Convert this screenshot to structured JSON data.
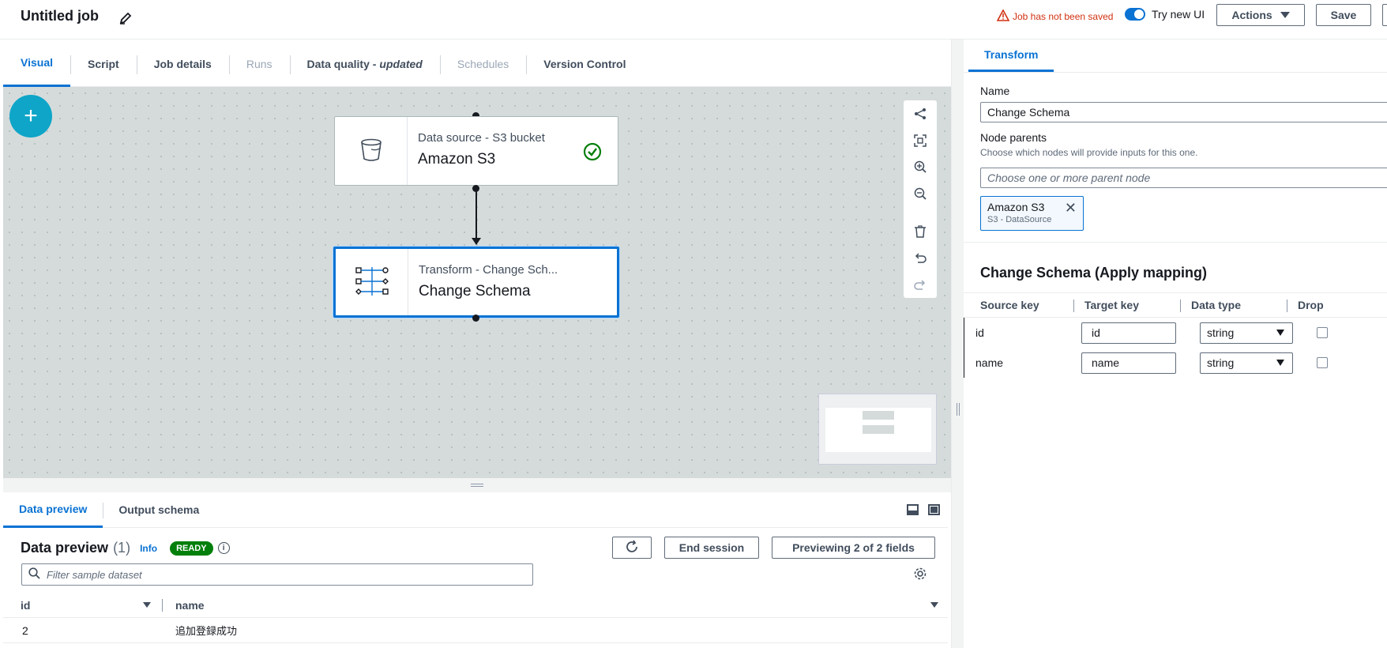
{
  "header": {
    "job_title": "Untitled job",
    "unsaved_warning": "Job has not been saved",
    "try_new_ui_label": "Try new UI",
    "actions_label": "Actions",
    "save_label": "Save"
  },
  "tabs": [
    {
      "label": "Visual",
      "state": "active"
    },
    {
      "label": "Script",
      "state": "normal"
    },
    {
      "label": "Job details",
      "state": "normal"
    },
    {
      "label": "Runs",
      "state": "disabled"
    },
    {
      "label": "Data quality -",
      "suffix": "updated",
      "state": "normal"
    },
    {
      "label": "Schedules",
      "state": "disabled"
    },
    {
      "label": "Version Control",
      "state": "normal"
    }
  ],
  "canvas": {
    "add_node_label": "+",
    "nodes": [
      {
        "subtitle": "Data source - S3 bucket",
        "title": "Amazon S3",
        "status": "success"
      },
      {
        "subtitle": "Transform - Change Sch...",
        "title": "Change Schema",
        "selected": true
      }
    ],
    "toolbar_icons": [
      "share-icon",
      "fit-view-icon",
      "zoom-in-icon",
      "zoom-out-icon",
      "delete-icon",
      "undo-icon",
      "redo-icon"
    ]
  },
  "bottom_panel": {
    "tabs": [
      "Data preview",
      "Output schema"
    ],
    "title": "Data preview",
    "count": "(1)",
    "info_label": "Info",
    "status_badge": "READY",
    "end_session_label": "End session",
    "previewing_label": "Previewing 2 of 2 fields",
    "filter_placeholder": "Filter sample dataset",
    "columns": [
      "id",
      "name"
    ],
    "rows": [
      {
        "id": "2",
        "name": "追加登録成功"
      }
    ]
  },
  "right_panel": {
    "tab_label": "Transform",
    "name_label": "Name",
    "name_value": "Change Schema",
    "node_parents_label": "Node parents",
    "node_parents_desc": "Choose which nodes will provide inputs for this one.",
    "node_parents_placeholder": "Choose one or more parent node",
    "token": {
      "title": "Amazon S3",
      "subtitle": "S3 - DataSource"
    },
    "mapping_title": "Change Schema (Apply mapping)",
    "mapping_headers": [
      "Source key",
      "Target key",
      "Data type",
      "Drop"
    ],
    "mappings": [
      {
        "source": "id",
        "target": "id",
        "type": "string",
        "drop": false
      },
      {
        "source": "name",
        "target": "name",
        "type": "string",
        "drop": false
      }
    ]
  },
  "colors": {
    "accent": "#0972d3",
    "add_button": "#0ea5c8",
    "success": "#037f0c",
    "warning": "#d13212"
  }
}
